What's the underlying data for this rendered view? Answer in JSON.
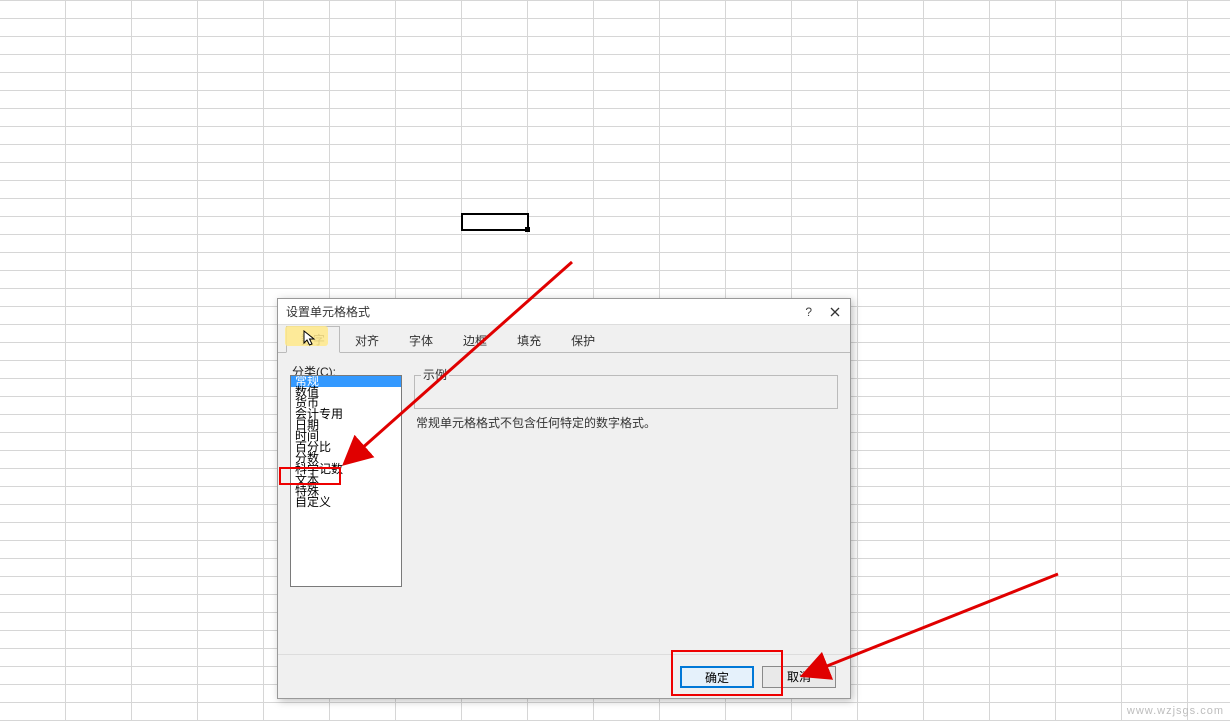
{
  "dialog": {
    "title": "设置单元格格式",
    "help_symbol": "?",
    "tabs": [
      "数字",
      "对齐",
      "字体",
      "边框",
      "填充",
      "保护"
    ],
    "active_tab_index": 0,
    "category_label": "分类(C):",
    "categories": [
      "常规",
      "数值",
      "货币",
      "会计专用",
      "日期",
      "时间",
      "百分比",
      "分数",
      "科学记数",
      "文本",
      "特殊",
      "自定义"
    ],
    "selected_category_index": 0,
    "highlighted_category_text": "文本",
    "sample_label": "示例",
    "description": "常规单元格格式不包含任何特定的数字格式。",
    "ok_label": "确定",
    "cancel_label": "取消"
  },
  "annotation": {
    "arrow_color": "#e00000"
  },
  "watermark": "www.wzjsgs.com"
}
